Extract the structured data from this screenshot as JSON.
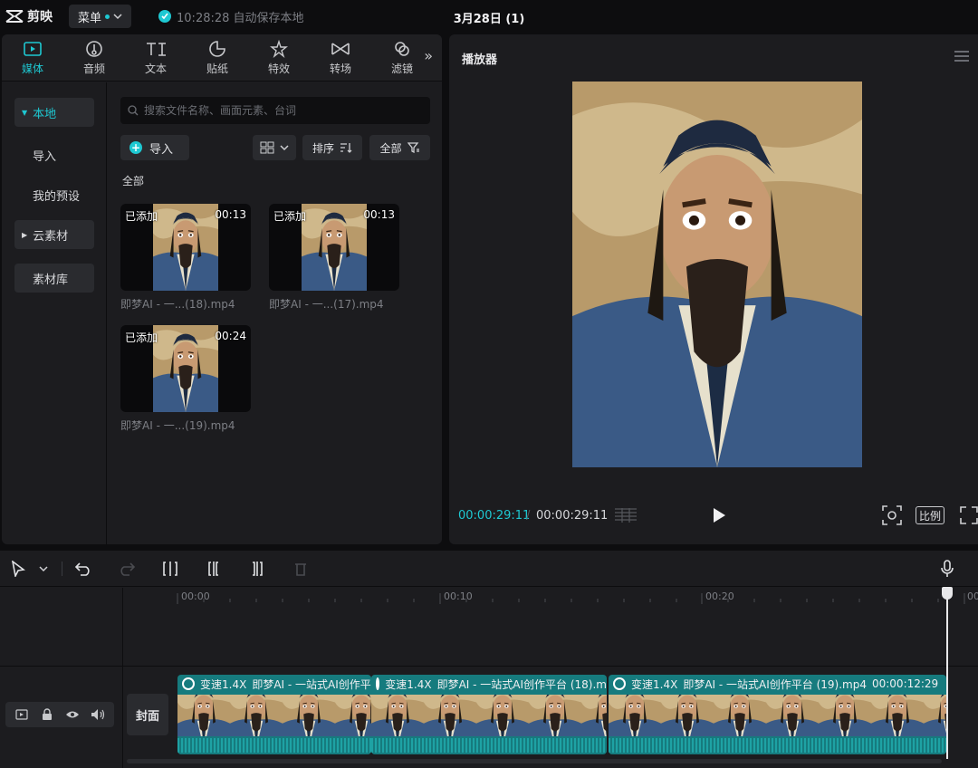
{
  "topbar": {
    "app_name": "剪映",
    "menu_label": "菜单",
    "save_status": "10:28:28 自动保存本地",
    "project_title": "3月28日 (1)"
  },
  "tabs": [
    {
      "label": "媒体",
      "icon": "media-icon",
      "active": true
    },
    {
      "label": "音频",
      "icon": "audio-icon"
    },
    {
      "label": "文本",
      "icon": "text-icon"
    },
    {
      "label": "贴纸",
      "icon": "sticker-icon"
    },
    {
      "label": "特效",
      "icon": "effects-icon"
    },
    {
      "label": "转场",
      "icon": "transition-icon"
    },
    {
      "label": "滤镜",
      "icon": "filter-icon"
    }
  ],
  "sidebar": {
    "local": "本地",
    "import": "导入",
    "presets": "我的预设",
    "cloud": "云素材",
    "library": "素材库"
  },
  "media": {
    "search_placeholder": "搜索文件名称、画面元素、台词",
    "import_label": "导入",
    "sort_label": "排序",
    "filter_label": "全部",
    "section_label": "全部",
    "items": [
      {
        "added": "已添加",
        "duration": "00:13",
        "name": "即梦AI - 一...(18).mp4"
      },
      {
        "added": "已添加",
        "duration": "00:13",
        "name": "即梦AI - 一...(17).mp4"
      },
      {
        "added": "已添加",
        "duration": "00:24",
        "name": "即梦AI - 一...(19).mp4"
      }
    ]
  },
  "player": {
    "title": "播放器",
    "current_time": "00:00:29:11",
    "total_time": "00:00:29:11",
    "ratio_label": "比例"
  },
  "timeline": {
    "ruler": [
      "00:00",
      "00:10",
      "00:20",
      "00"
    ],
    "cover_label": "封面",
    "clips": [
      {
        "speed": "变速1.4X",
        "name": "即梦AI - 一站式AI创作平"
      },
      {
        "speed": "变速1.4X",
        "name": "即梦AI - 一站式AI创作平台 (18).m"
      },
      {
        "speed": "变速1.4X",
        "name": "即梦AI - 一站式AI创作平台 (19).mp4",
        "duration": "00:00:12:29"
      }
    ]
  },
  "colors": {
    "accent": "#1ec8d2",
    "clip": "#167b7e",
    "panel": "#1c1c1f",
    "bg": "#0d0d0f"
  }
}
